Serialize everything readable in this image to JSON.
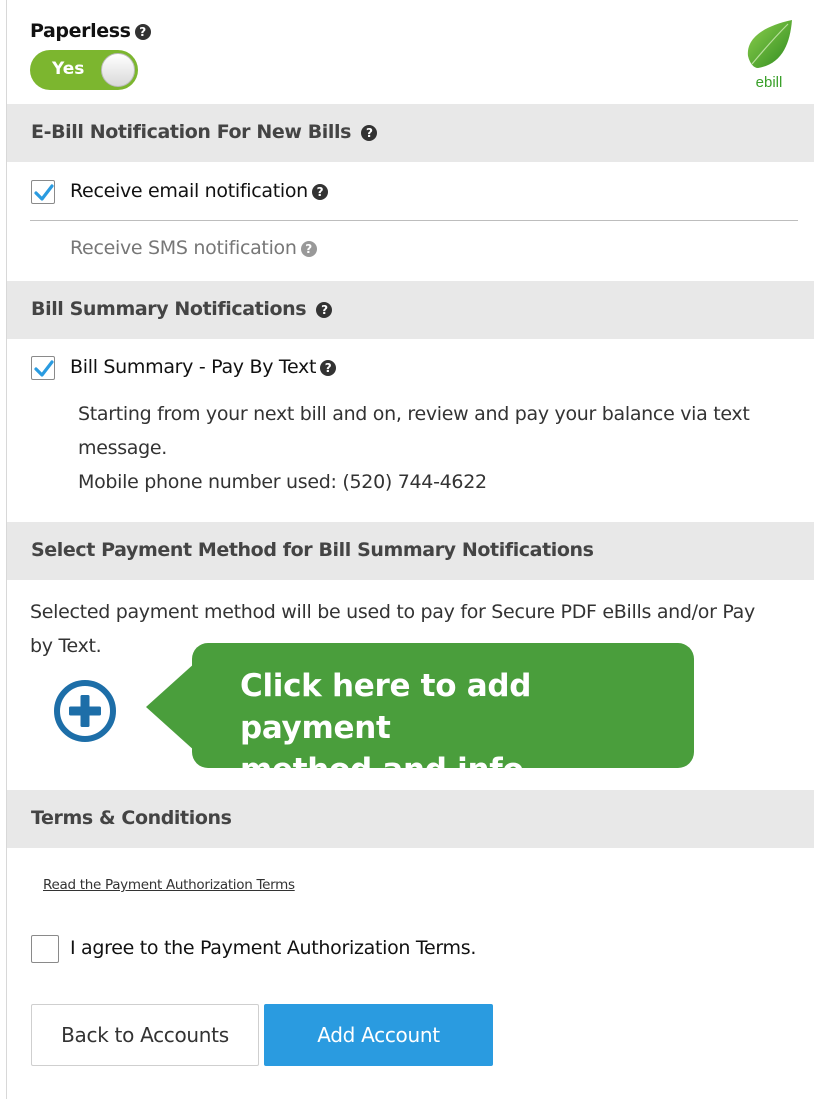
{
  "paperless": {
    "label": "Paperless",
    "toggle_value": "Yes",
    "logo_text": "ebill"
  },
  "ebill_section": {
    "title": "E-Bill Notification For New Bills",
    "email_label": "Receive email notification",
    "email_checked": true,
    "sms_label": "Receive SMS notification"
  },
  "bill_summary": {
    "title": "Bill Summary Notifications",
    "pay_by_text_label": "Bill Summary - Pay By Text",
    "pay_by_text_checked": true,
    "description_line1": "Starting from your next bill and on, review and pay your balance via text",
    "description_line2": "message.",
    "phone_line": "Mobile phone number used: (520) 744-4622"
  },
  "payment_method": {
    "title": "Select Payment Method for Bill Summary Notifications",
    "description_line1": "Selected payment method will be used to pay for Secure PDF eBills and/or Pay",
    "description_line2": "by Text.",
    "callout_line1": "Click here to add payment",
    "callout_line2": "method and info"
  },
  "terms": {
    "title": "Terms & Conditions",
    "link_text": "Read the Payment Authorization Terms",
    "agree_label": "I agree to the Payment Authorization Terms.",
    "agree_checked": false
  },
  "buttons": {
    "back_label": "Back to Accounts",
    "add_label": "Add Account"
  },
  "colors": {
    "toggle_green": "#7cb62f",
    "callout_green": "#4a9e3c",
    "primary_blue": "#2a9be0",
    "plus_blue": "#1d6ea8",
    "section_grey": "#e8e8e8"
  },
  "icons": {
    "help": "question-circle-icon",
    "checkmark": "checkmark-icon",
    "add": "plus-circle-icon",
    "logo": "leaf-icon"
  }
}
